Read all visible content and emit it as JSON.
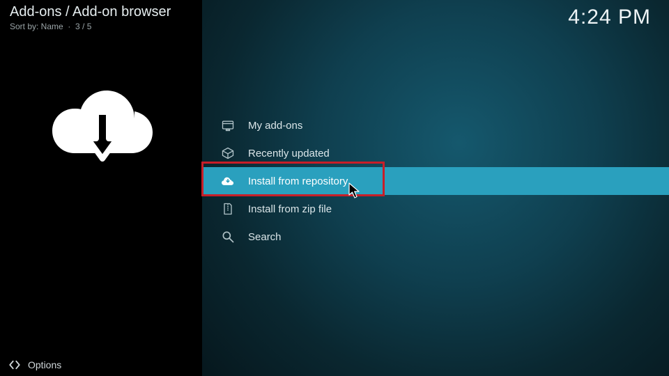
{
  "header": {
    "breadcrumb": "Add-ons / Add-on browser",
    "sort_label": "Sort by: Name",
    "position": "3 / 5",
    "clock": "4:24 PM"
  },
  "menu": {
    "items": [
      {
        "label": "My add-ons",
        "icon": "addons-icon"
      },
      {
        "label": "Recently updated",
        "icon": "box-open-icon"
      },
      {
        "label": "Install from repository",
        "icon": "cloud-download-icon",
        "selected": true
      },
      {
        "label": "Install from zip file",
        "icon": "zip-file-icon"
      },
      {
        "label": "Search",
        "icon": "search-icon"
      }
    ]
  },
  "footer": {
    "options_label": "Options"
  },
  "annotation": {
    "highlighted_item_index": 2
  }
}
